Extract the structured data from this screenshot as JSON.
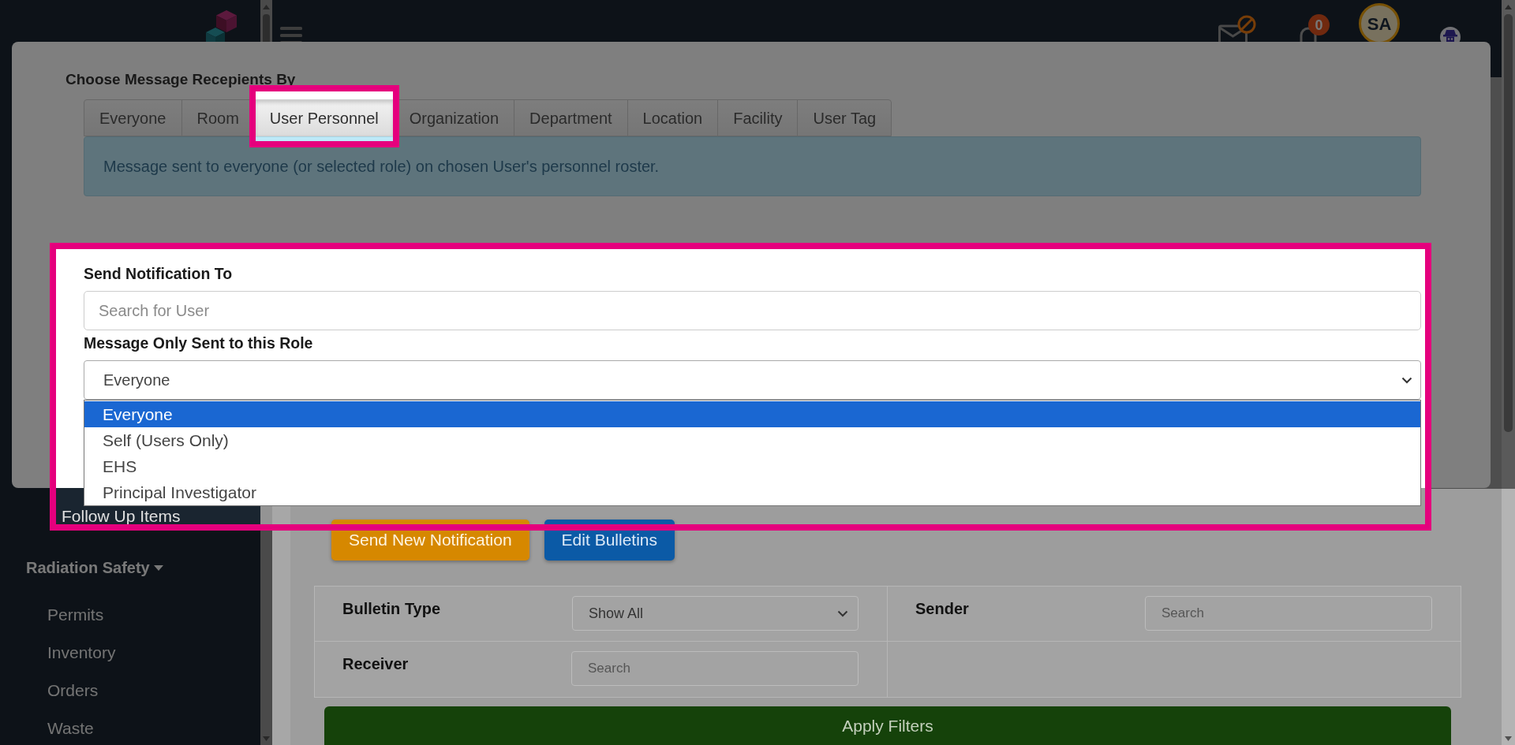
{
  "top_bar": {
    "notification_badge": "0",
    "avatar_initials": "SA"
  },
  "sidebar": {
    "items": [
      {
        "kind": "link",
        "label": "Follow Up Items"
      },
      {
        "kind": "section",
        "label": "Radiation Safety",
        "expanded": true,
        "children": [
          {
            "label": "Permits"
          },
          {
            "label": "Inventory"
          },
          {
            "label": "Orders"
          },
          {
            "label": "Waste"
          }
        ]
      }
    ]
  },
  "page": {
    "buttons": [
      {
        "kind": "warning",
        "label": "Send New Notification"
      },
      {
        "kind": "primary",
        "label": "Edit Bulletins"
      }
    ],
    "filters": [
      {
        "kind": "select",
        "label": "Bulletin Type",
        "value": "Show All"
      },
      {
        "kind": "search",
        "label": "Sender",
        "placeholder": "Search"
      },
      {
        "kind": "search",
        "label": "Receiver",
        "placeholder": "Search"
      }
    ],
    "apply_button": {
      "label": "Apply Filters"
    }
  },
  "modal": {
    "title": "Choose Message Recepients By",
    "tabs": [
      {
        "label": "Everyone",
        "selected": false
      },
      {
        "label": "Room",
        "selected": false
      },
      {
        "label": "User Personnel",
        "selected": true
      },
      {
        "label": "Organization",
        "selected": false
      },
      {
        "label": "Department",
        "selected": false
      },
      {
        "label": "Location",
        "selected": false
      },
      {
        "label": "Facility",
        "selected": false
      },
      {
        "label": "User Tag",
        "selected": false
      }
    ],
    "info": "Message sent to everyone (or selected role) on chosen User's personnel roster.",
    "fields": [
      {
        "kind": "search",
        "label": "Send Notification To",
        "placeholder": "Search for User"
      },
      {
        "kind": "select",
        "label": "Message Only Sent to this Role",
        "value": "Everyone",
        "expanded": true,
        "options": [
          {
            "label": "Everyone",
            "selected": true
          },
          {
            "label": "Self (Users Only)",
            "selected": false
          },
          {
            "label": "EHS",
            "selected": false
          },
          {
            "label": "Principal Investigator",
            "selected": false
          }
        ]
      }
    ]
  }
}
